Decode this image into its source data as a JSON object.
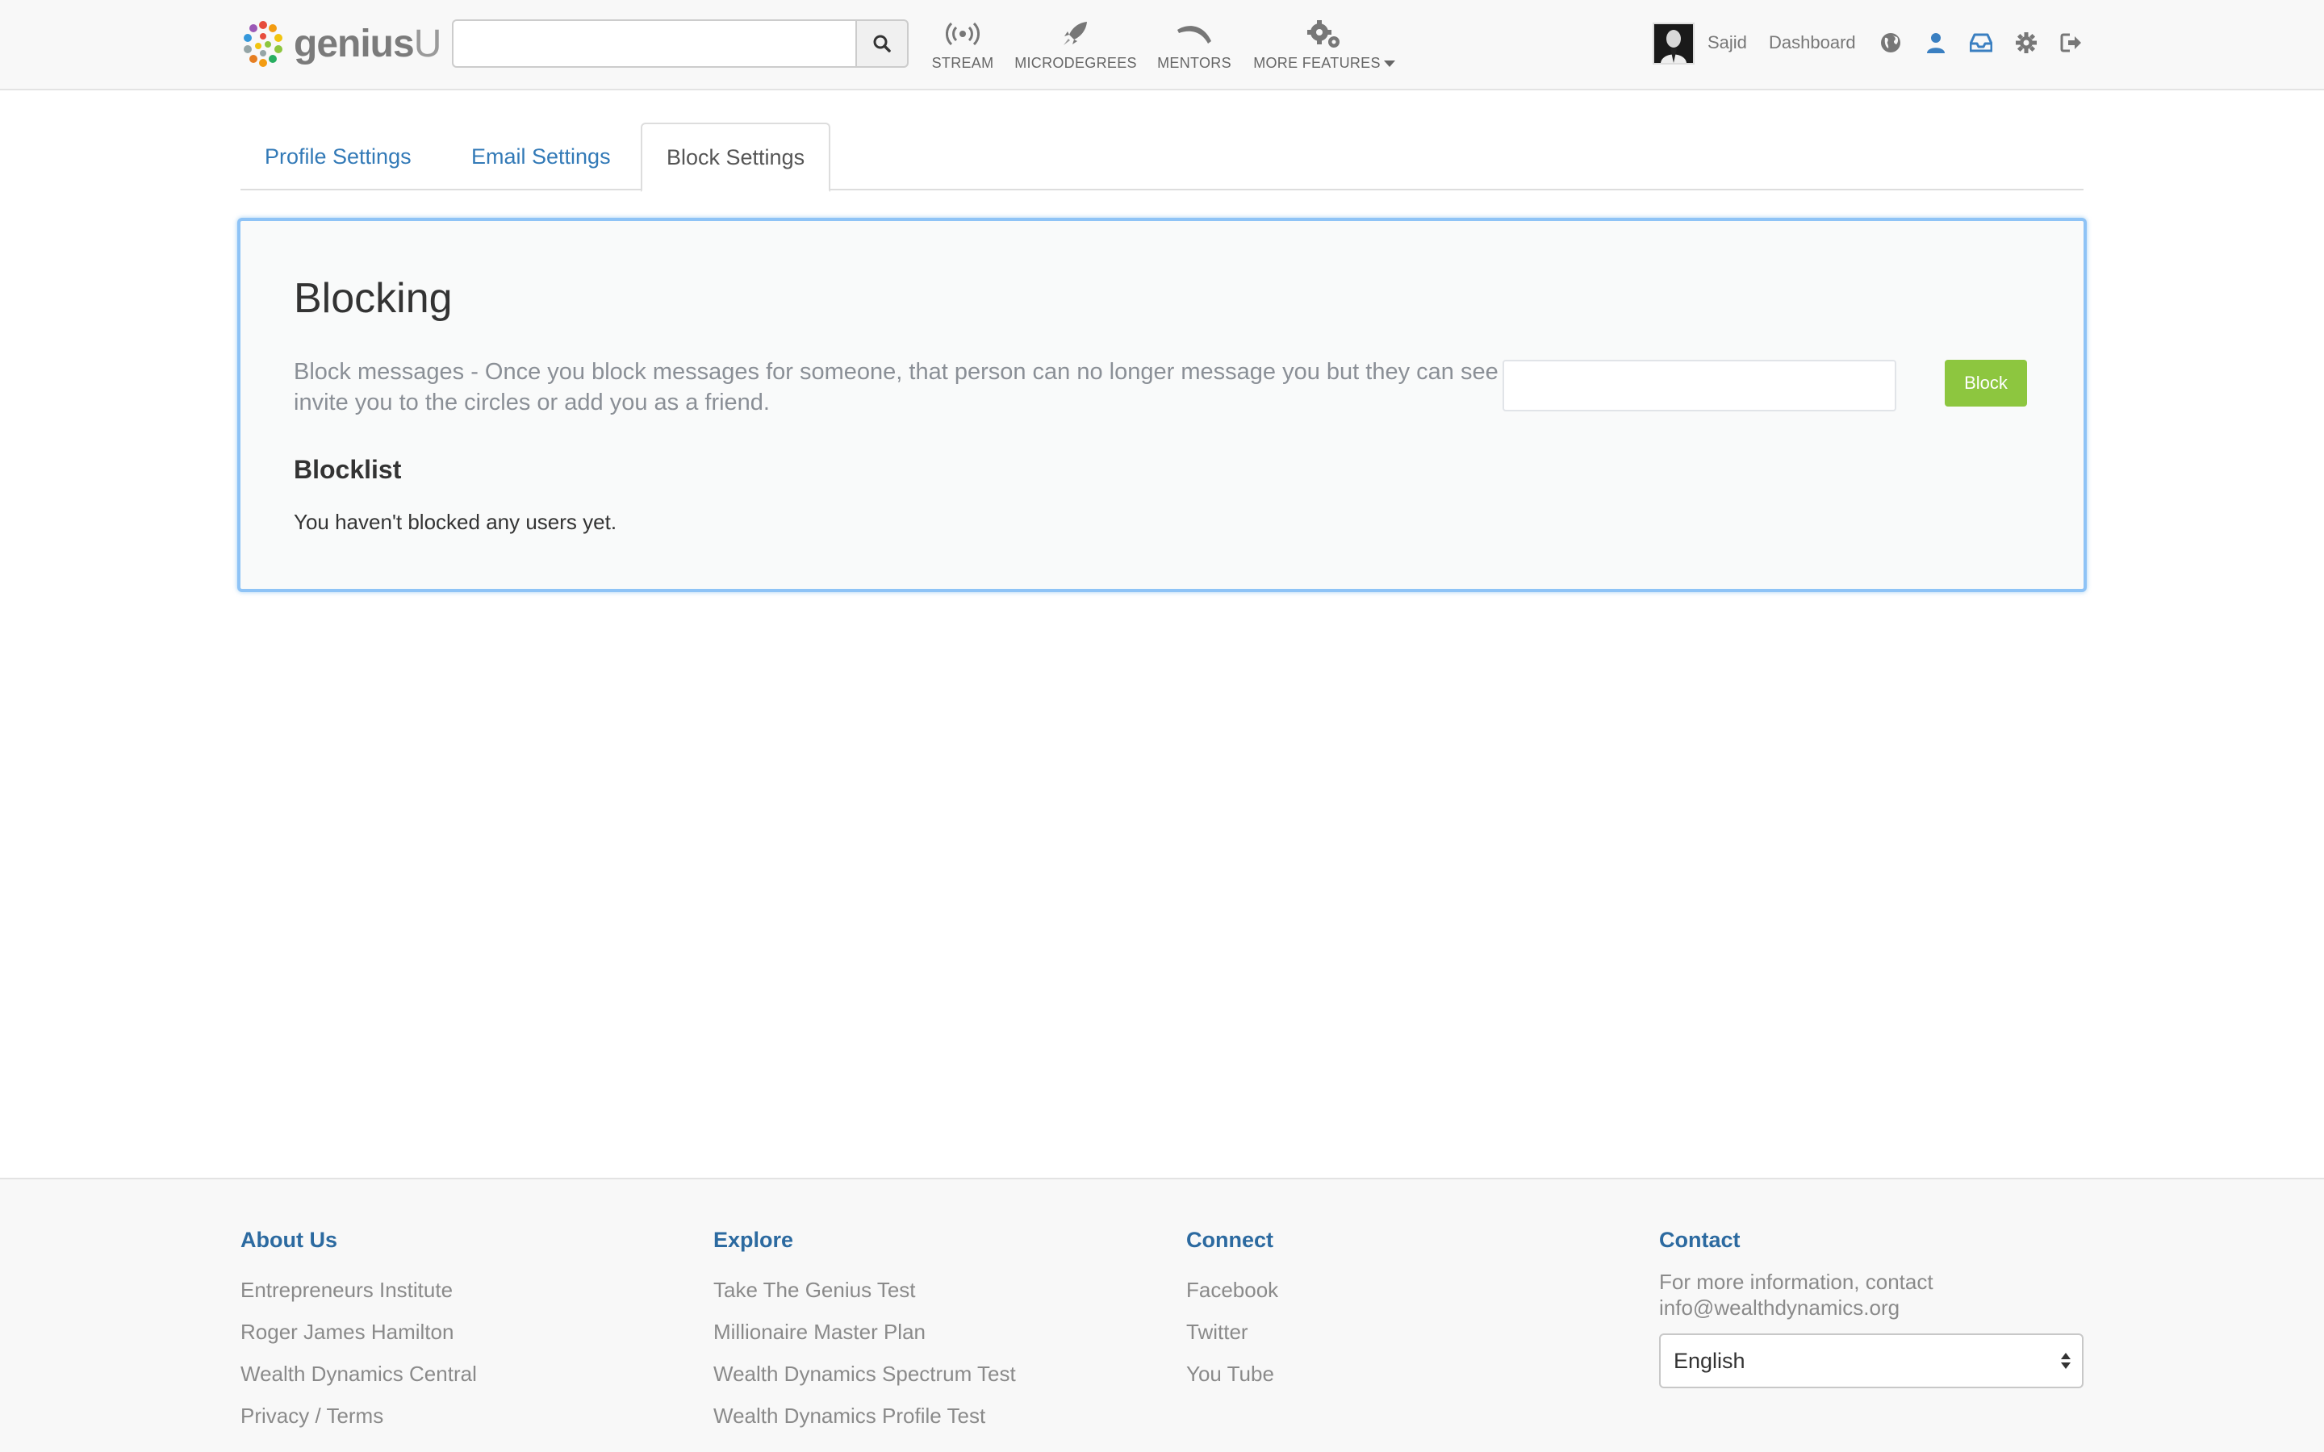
{
  "brand": {
    "name_bold": "genius",
    "name_light": "U"
  },
  "search": {
    "placeholder": "",
    "value": ""
  },
  "nav": {
    "items": [
      {
        "label": "STREAM",
        "icon": "broadcast-icon"
      },
      {
        "label": "MICRODEGREES",
        "icon": "rocket-icon"
      },
      {
        "label": "MENTORS",
        "icon": "boomerang-icon"
      },
      {
        "label": "MORE FEATURES",
        "icon": "gears-icon"
      }
    ]
  },
  "user": {
    "name": "Sajid",
    "dashboard_label": "Dashboard"
  },
  "top_icons": [
    "globe-icon",
    "user-icon",
    "inbox-icon",
    "gear-icon",
    "sign-out-icon"
  ],
  "tabs": [
    {
      "label": "Profile Settings",
      "active": false
    },
    {
      "label": "Email Settings",
      "active": false
    },
    {
      "label": "Block Settings",
      "active": true
    }
  ],
  "blocking": {
    "title": "Blocking",
    "description": "Block messages - Once you block messages for someone, that person can no longer message you but they can see things you post, invite you to the circles or add you as a friend.",
    "input_placeholder": "",
    "button_label": "Block",
    "blocklist_title": "Blocklist",
    "blocklist_empty": "You haven't blocked any users yet."
  },
  "footer": {
    "about": {
      "heading": "About Us",
      "links": [
        "Entrepreneurs Institute",
        "Roger James Hamilton",
        "Wealth Dynamics Central",
        "Privacy / Terms"
      ]
    },
    "explore": {
      "heading": "Explore",
      "links": [
        "Take The Genius Test",
        "Millionaire Master Plan",
        "Wealth Dynamics Spectrum Test",
        "Wealth Dynamics Profile Test"
      ]
    },
    "connect": {
      "heading": "Connect",
      "links": [
        "Facebook",
        "Twitter",
        "You Tube"
      ]
    },
    "contact": {
      "heading": "Contact",
      "text": "For more information, contact info@wealthdynamics.org",
      "language": "English"
    }
  },
  "colors": {
    "link": "#337ab7",
    "footer_heading": "#2c6aa0",
    "block_button": "#8dc63f",
    "panel_focus_border": "#8ec3f6"
  }
}
